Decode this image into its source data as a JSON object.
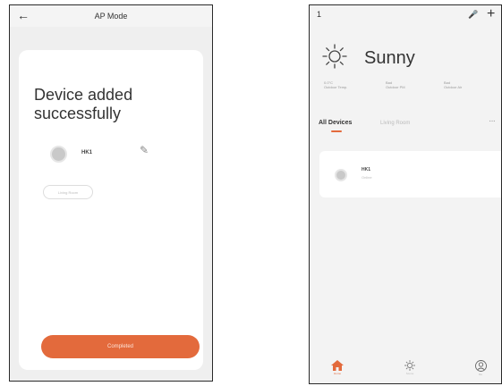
{
  "left_screen": {
    "header_title": "AP Mode",
    "message": "Device added successfully",
    "device_name": "HK1",
    "pill_label": "Living Room",
    "complete_label": "Completed"
  },
  "right_screen": {
    "status_time": "1",
    "weather": "Sunny",
    "stats": [
      {
        "value": "0.0°C",
        "label": "Outdoor Temp."
      },
      {
        "value": "Bad",
        "label": "Outdoor PM"
      },
      {
        "value": "Bad",
        "label": "Outdoor Air"
      }
    ],
    "tabs": {
      "active": "All Devices",
      "other": "Living Room"
    },
    "more_label": "···",
    "device": {
      "name": "HK1",
      "status": "Online"
    },
    "nav": [
      "Home",
      "Scene",
      "Me"
    ]
  },
  "colors": {
    "accent": "#e36a3c",
    "background": "#f3f3f3"
  },
  "icons": [
    "back-arrow-icon",
    "edit-pencil-icon",
    "sun-icon",
    "mic-icon",
    "plus-icon",
    "home-icon",
    "scene-icon",
    "profile-icon"
  ]
}
